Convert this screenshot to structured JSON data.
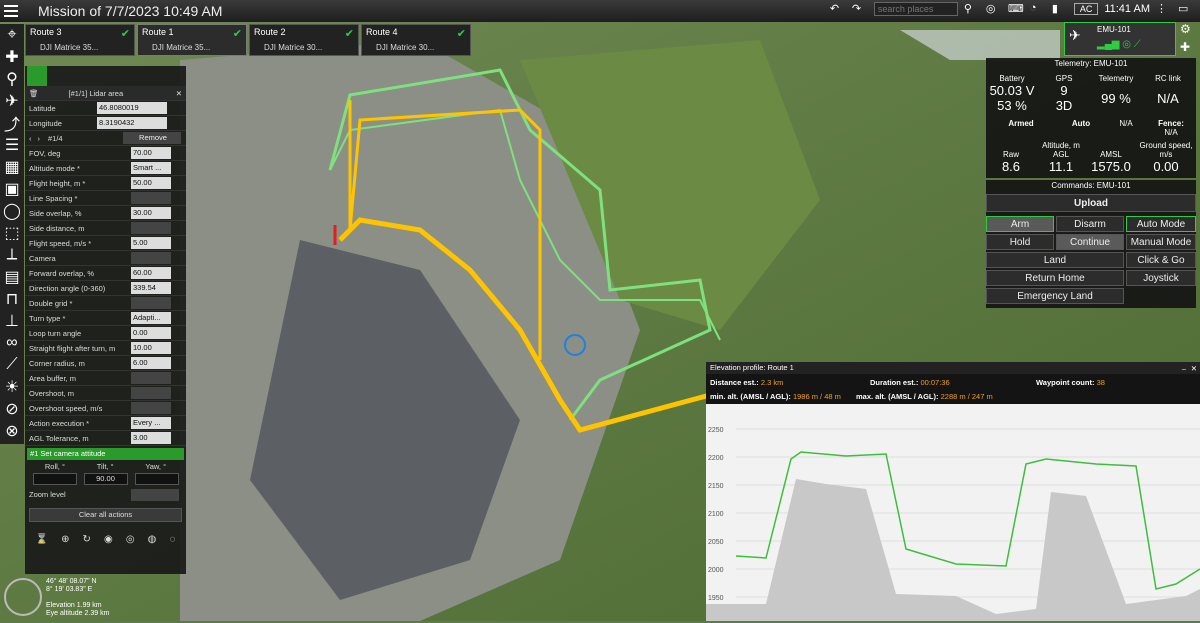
{
  "app": {
    "title": "Mission of 7/7/2023 10:49 AM"
  },
  "topbar": {
    "search_placeholder": "search places",
    "ac_label": "AC",
    "time": "11:41 AM"
  },
  "routes": [
    {
      "name": "Route 3",
      "vehicle": "DJI Matrice 35..."
    },
    {
      "name": "Route 1",
      "vehicle": "DJI Matrice 35..."
    },
    {
      "name": "Route 2",
      "vehicle": "DJI Matrice 30..."
    },
    {
      "name": "Route 4",
      "vehicle": "DJI Matrice 30..."
    }
  ],
  "panel": {
    "title": "[#1/1] Lidar area",
    "latitude_label": "Latitude",
    "latitude": "46.8080019",
    "longitude_label": "Longitude",
    "longitude": "8.3190432",
    "nav": "#1/4",
    "remove": "Remove",
    "fields": [
      {
        "label": "FOV, deg",
        "value": "70.00"
      },
      {
        "label": "Altitude mode *",
        "value": "Smart ..."
      },
      {
        "label": "Flight height, m *",
        "value": "50.00"
      },
      {
        "label": "Line Spacing *",
        "value": ""
      },
      {
        "label": "Side overlap, %",
        "value": "30.00"
      },
      {
        "label": "Side distance, m",
        "value": ""
      },
      {
        "label": "Flight speed, m/s *",
        "value": "5.00"
      },
      {
        "label": "Camera",
        "value": ""
      },
      {
        "label": "Forward overlap, %",
        "value": "60.00"
      },
      {
        "label": "Direction angle (0-360)",
        "value": "339.54"
      },
      {
        "label": "Double grid *",
        "value": ""
      },
      {
        "label": "Turn type *",
        "value": "Adapti..."
      },
      {
        "label": "Loop turn angle",
        "value": "0.00"
      },
      {
        "label": "Straight flight after turn, m",
        "value": "10.00"
      },
      {
        "label": "Corner radius, m",
        "value": "6.00"
      },
      {
        "label": "Area buffer, m",
        "value": ""
      },
      {
        "label": "Overshoot, m",
        "value": ""
      },
      {
        "label": "Overshoot speed, m/s",
        "value": ""
      },
      {
        "label": "Action execution *",
        "value": "Every ..."
      },
      {
        "label": "AGL Tolerance, m",
        "value": "3.00"
      }
    ],
    "action_title": "#1 Set camera attitude",
    "roll_label": "Roll, °",
    "tilt_label": "Tilt, °",
    "yaw_label": "Yaw, °",
    "tilt_value": "90.00",
    "zoom_label": "Zoom level",
    "clear_actions": "Clear all actions"
  },
  "emu": {
    "name": "EMU-101"
  },
  "telemetry": {
    "title": "Telemetry: EMU-101",
    "battery_label": "Battery",
    "battery_v": "50.03 V",
    "battery_pct": "53 %",
    "gps_label": "GPS",
    "gps_sats": "9",
    "gps_fix": "3D",
    "tele_label": "Telemetry",
    "tele_value": "99 %",
    "rc_label": "RC link",
    "rc_value": "N/A",
    "armed": "Armed",
    "auto": "Auto",
    "na": "N/A",
    "fence": "Fence:",
    "fence_value": "N/A",
    "alt_label": "Altitude, m",
    "raw_label": "Raw",
    "raw": "8.6",
    "agl_label": "AGL",
    "agl": "11.1",
    "amsl_label": "AMSL",
    "amsl": "1575.0",
    "gs_label": "Ground speed, m/s",
    "gs": "0.00"
  },
  "commands": {
    "title": "Commands: EMU-101",
    "upload": "Upload",
    "arm": "Arm",
    "disarm": "Disarm",
    "auto_mode": "Auto Mode",
    "hold": "Hold",
    "continue": "Continue",
    "manual_mode": "Manual Mode",
    "land": "Land",
    "click_go": "Click & Go",
    "return_home": "Return Home",
    "joystick": "Joystick",
    "emergency_land": "Emergency Land"
  },
  "elevation": {
    "title": "Elevation profile: Route 1",
    "dist_label": "Distance est.:",
    "dist": "2.3 km",
    "dur_label": "Duration est.:",
    "dur": "00:07:36",
    "wp_label": "Waypoint count:",
    "wp": "38",
    "min_label": "min. alt. (AMSL / AGL):",
    "min": "1986 m / 48 m",
    "max_label": "max. alt. (AMSL / AGL):",
    "max": "2288 m / 247 m",
    "yticks": [
      "2250",
      "2200",
      "2150",
      "2100",
      "2050",
      "2000",
      "1950"
    ]
  },
  "coords": {
    "lat": "46° 48' 08.07\" N",
    "lon": "8° 19' 03.83\" E",
    "elev": "Elevation 1.99 km",
    "eye": "Eye altitude 2.39 km"
  },
  "colors": {
    "accent": "#2ecc40",
    "path": "#ffc400",
    "route": "#7fe07f"
  }
}
